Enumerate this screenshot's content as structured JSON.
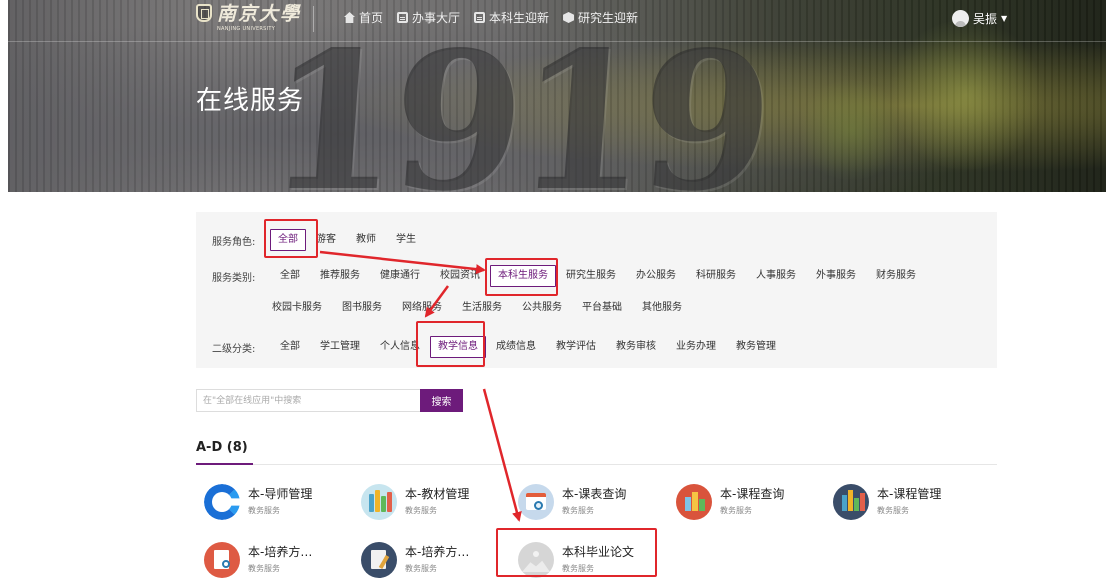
{
  "header": {
    "logo_cn": "南京大學",
    "logo_en": "NANJING UNIVERSITY",
    "nav": [
      {
        "label": "首页",
        "icon": "home-icon"
      },
      {
        "label": "办事大厅",
        "icon": "document-icon"
      },
      {
        "label": "本科生迎新",
        "icon": "document-icon"
      },
      {
        "label": "研究生迎新",
        "icon": "cube-icon"
      }
    ],
    "user_name": "吴振",
    "hero_number": "1919",
    "page_title": "在线服务"
  },
  "filters": {
    "role": {
      "label": "服务角色:",
      "options": [
        "全部",
        "游客",
        "教师",
        "学生"
      ],
      "selected": "全部"
    },
    "category": {
      "label": "服务类别:",
      "options_row1": [
        "全部",
        "推荐服务",
        "健康通行",
        "校园资讯",
        "本科生服务",
        "研究生服务",
        "办公服务",
        "科研服务",
        "人事服务",
        "外事服务",
        "财务服务"
      ],
      "options_row2": [
        "校园卡服务",
        "图书服务",
        "网络服务",
        "生活服务",
        "公共服务",
        "平台基础",
        "其他服务"
      ],
      "selected": "本科生服务"
    },
    "subcategory": {
      "label": "二级分类:",
      "options": [
        "全部",
        "学工管理",
        "个人信息",
        "教学信息",
        "成绩信息",
        "教学评估",
        "教务审核",
        "业务办理",
        "教务管理"
      ],
      "selected": "教学信息"
    }
  },
  "search": {
    "placeholder": "在\"全部在线应用\"中搜索",
    "button_label": "搜索"
  },
  "section": {
    "heading": "A-D (8)"
  },
  "apps": [
    {
      "title": "本-导师管理",
      "subtitle": "教务服务"
    },
    {
      "title": "本-教材管理",
      "subtitle": "教务服务"
    },
    {
      "title": "本-课表查询",
      "subtitle": "教务服务"
    },
    {
      "title": "本-课程查询",
      "subtitle": "教务服务"
    },
    {
      "title": "本-课程管理",
      "subtitle": "教务服务"
    },
    {
      "title": "本-培养方…",
      "subtitle": "教务服务"
    },
    {
      "title": "本-培养方…",
      "subtitle": "教务服务"
    },
    {
      "title": "本科毕业论文",
      "subtitle": "教务服务"
    }
  ],
  "colors": {
    "accent": "#6d1b7b",
    "annotation": "#e0262b"
  }
}
